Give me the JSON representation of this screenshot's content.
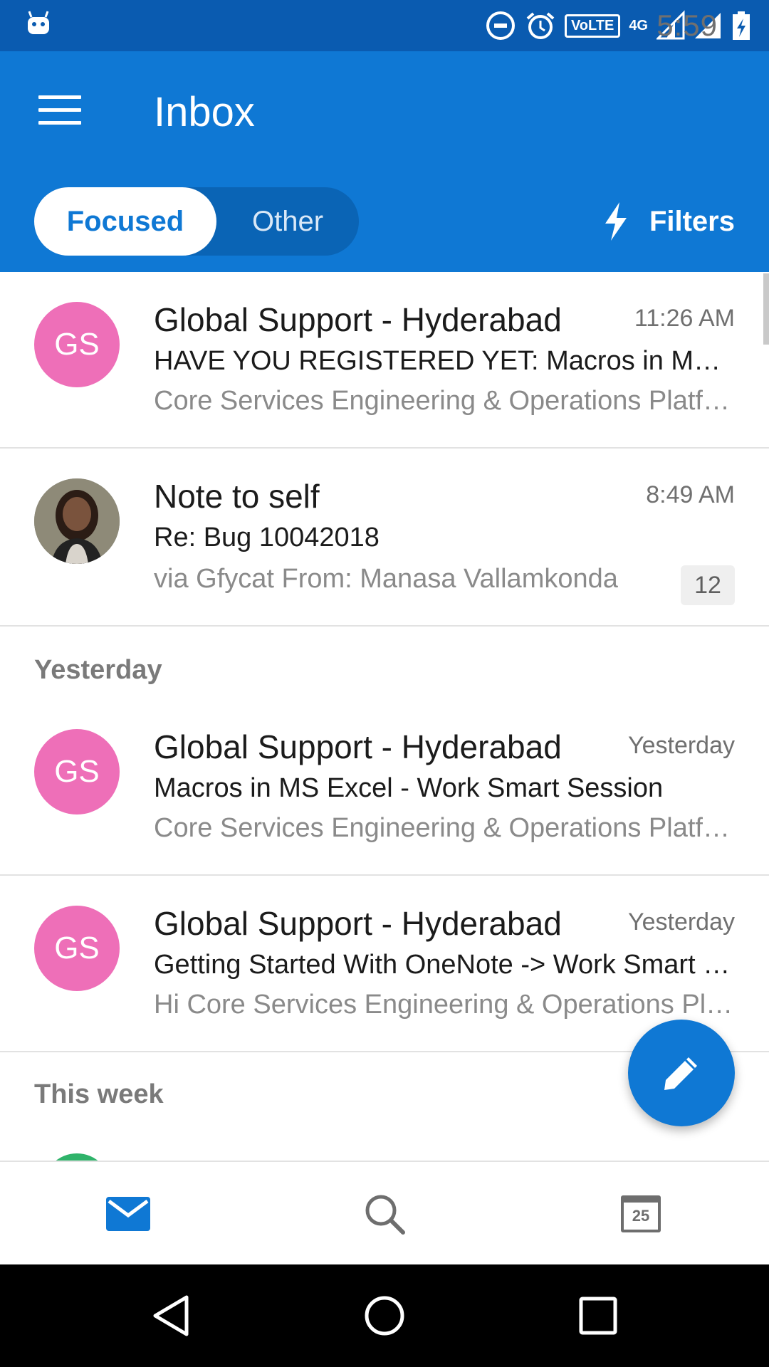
{
  "status_bar": {
    "time": "5:59",
    "volte_label": "VoLTE",
    "network_label": "4G",
    "icons": [
      "android-icon",
      "dnd-icon",
      "alarm-icon",
      "volte-icon",
      "signal-icon",
      "signal-icon",
      "battery-icon"
    ]
  },
  "app_bar": {
    "title": "Inbox",
    "tabs": {
      "focused": "Focused",
      "other": "Other"
    },
    "filters_label": "Filters"
  },
  "messages_top": [
    {
      "avatar": "GS",
      "sender": "Global Support - Hyderabad",
      "time": "11:26 AM",
      "subject": "HAVE YOU REGISTERED YET: Macros in MS Excel - Work Smart Session",
      "preview": "Core Services Engineering & Operations Platform"
    },
    {
      "avatar": "",
      "sender": "Note to self",
      "time": "8:49 AM",
      "subject": "Re: Bug 10042018",
      "preview": "via Gfycat From: Manasa Vallamkonda",
      "count": "12"
    }
  ],
  "sections": {
    "yesterday": "Yesterday",
    "this_week": "This week"
  },
  "messages_yesterday": [
    {
      "avatar": "GS",
      "sender": "Global Support - Hyderabad",
      "time": "Yesterday",
      "subject": "Macros in MS Excel - Work Smart Session",
      "preview": "Core Services Engineering & Operations Platform"
    },
    {
      "avatar": "GS",
      "sender": "Global Support - Hyderabad",
      "time": "Yesterday",
      "subject": "Getting Started With OneNote -> Work Smart Session",
      "preview": "Hi Core Services Engineering & Operations Platform"
    }
  ],
  "bottom_nav": {
    "calendar_day": "25"
  },
  "colors": {
    "status_bar": "#0a5bb0",
    "app_bar": "#0f78d4",
    "avatar_gs": "#ee6fb8",
    "accent": "#0f78d4"
  }
}
